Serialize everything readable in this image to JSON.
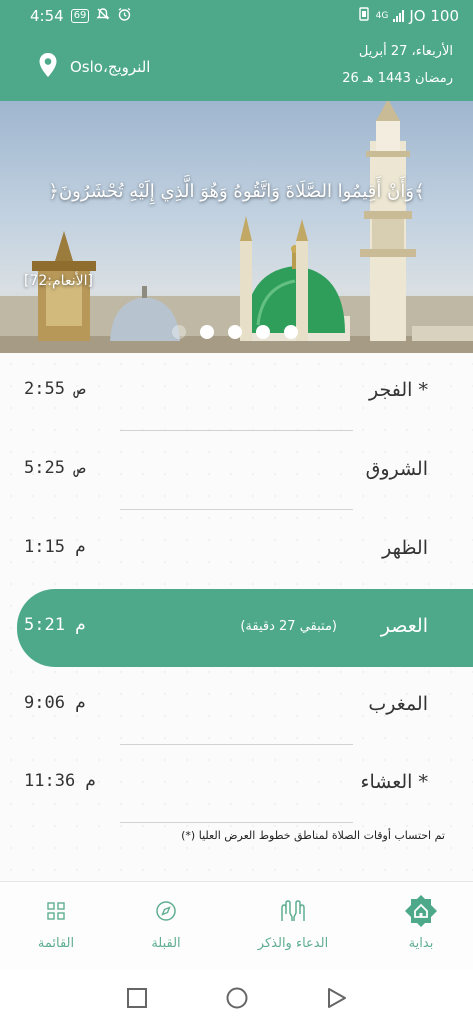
{
  "status_bar": {
    "time": "4:54",
    "badge": "69",
    "network": "4G",
    "carrier": "JO 100"
  },
  "header": {
    "location": "Oslo،النرويج",
    "gregorian_date": "الأربعاء، 27 أبريل",
    "hijri_date": "26 رمضان 1443 هـ"
  },
  "banner": {
    "verse": "﴿وَأَنْ أَقِيمُوا الصَّلَاةَ وَاتَّقُوهُ وَهُوَ الَّذِي إِلَيْهِ تُحْشَرُونَ﴾",
    "reference": "[الأنعام:72]",
    "slide_count": 5,
    "active_slide": 5
  },
  "prayers": [
    {
      "name": "الفجر *",
      "time": "2:55 ص"
    },
    {
      "name": "الشروق",
      "time": "5:25 ص"
    },
    {
      "name": "الظهر",
      "time": "1:15 م"
    },
    {
      "name": "العصر",
      "time": "5:21 م",
      "remaining": "(متبقي 27 دقيقة)",
      "active": true
    },
    {
      "name": "المغرب",
      "time": "9:06 م"
    },
    {
      "name": "العشاء *",
      "time": "11:36 م"
    }
  ],
  "note": "(*) تم احتساب أوقات الصلاة لمناطق خطوط العرض العليا",
  "bottom_nav": {
    "home": "بداية",
    "duas": "الدعاء والذكر",
    "qibla": "القبلة",
    "menu": "القائمة"
  },
  "colors": {
    "accent": "#4da98a",
    "nav_icon": "#5fae91"
  }
}
